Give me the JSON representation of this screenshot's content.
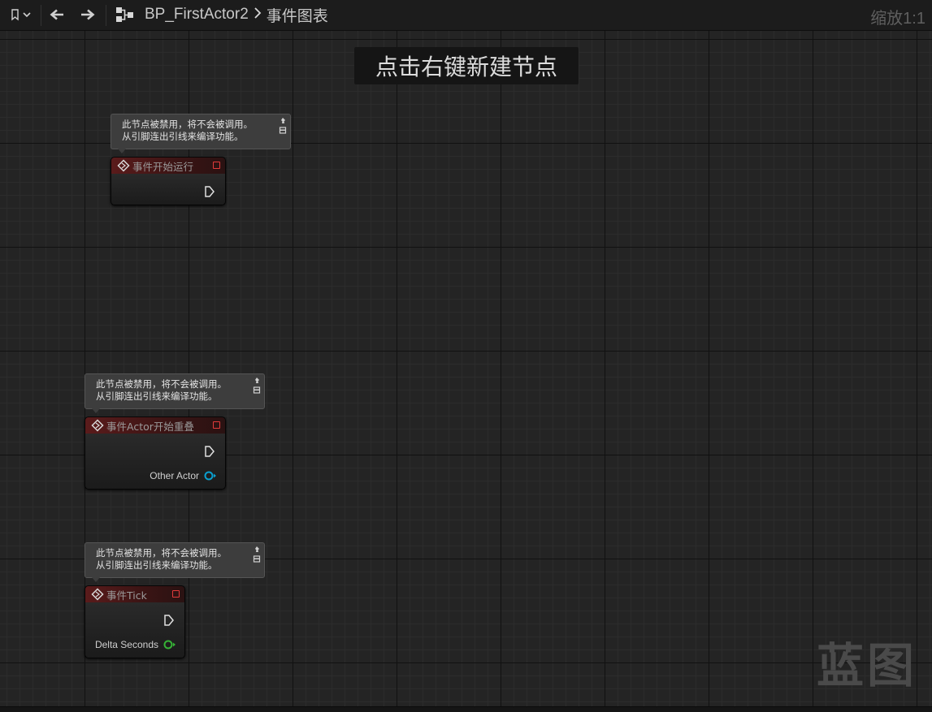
{
  "toolbar": {
    "bookmark_icon": "bookmark-icon",
    "back_icon": "arrow-left-icon",
    "forward_icon": "arrow-right-icon",
    "graph_icon": "blueprint-graph-icon"
  },
  "breadcrumb": {
    "asset": "BP_FirstActor2",
    "graph": "事件图表"
  },
  "zoom_label": "缩放1:1",
  "hint": "点击右键新建节点",
  "watermark": "蓝图",
  "comment_text": {
    "line1": "此节点被禁用，将不会被调用。",
    "line2": "从引脚连出引线来编译功能。"
  },
  "nodes": [
    {
      "title": "事件开始运行",
      "outputs": []
    },
    {
      "title": "事件Actor开始重叠",
      "outputs": [
        {
          "label": "Other Actor",
          "pin_color": "#0aa0d0"
        }
      ]
    },
    {
      "title": "事件Tick",
      "outputs": [
        {
          "label": "Delta Seconds",
          "pin_color": "#36b336"
        }
      ]
    }
  ],
  "colors": {
    "event_header": "#5a1b1b",
    "delegate_pin": "#e23b3b",
    "object_pin": "#0aa0d0",
    "float_pin": "#36b336"
  }
}
